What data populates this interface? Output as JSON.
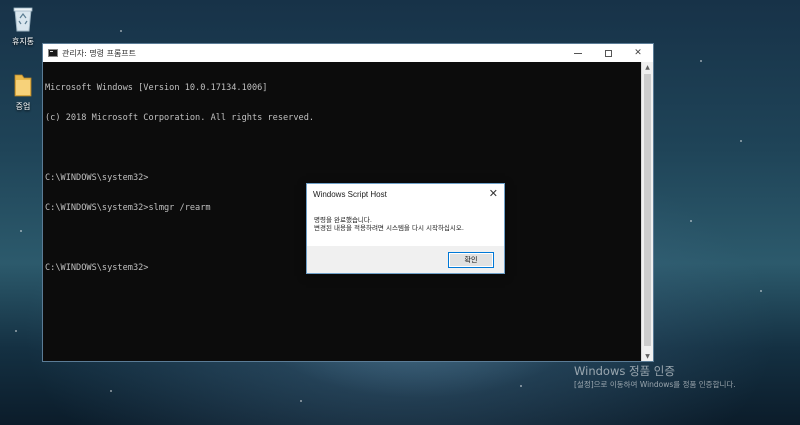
{
  "desktop": {
    "icons": [
      {
        "label": "휴지통",
        "icon": "recycle-bin-icon"
      },
      {
        "label": "증업",
        "icon": "folder-icon"
      }
    ],
    "activation": {
      "title": "Windows 정품 인증",
      "description": "[설정]으로 이동하여 Windows를 정품 인증합니다."
    }
  },
  "cmd_window": {
    "title": "관리자: 명령 프롬프트",
    "lines": [
      "Microsoft Windows [Version 10.0.17134.1006]",
      "(c) 2018 Microsoft Corporation. All rights reserved.",
      "",
      "C:\\WINDOWS\\system32>",
      "C:\\WINDOWS\\system32>slmgr /rearm",
      "",
      "C:\\WINDOWS\\system32>"
    ],
    "text_color": "#c0c0c0",
    "background": "#0c0c0c"
  },
  "dialog": {
    "title": "Windows Script Host",
    "message_line1": "명령을 완료했습니다.",
    "message_line2": "변경된 내용을 적용하려면 시스템을 다시 시작하십시오.",
    "ok_label": "확인",
    "accent": "#0078d7"
  }
}
